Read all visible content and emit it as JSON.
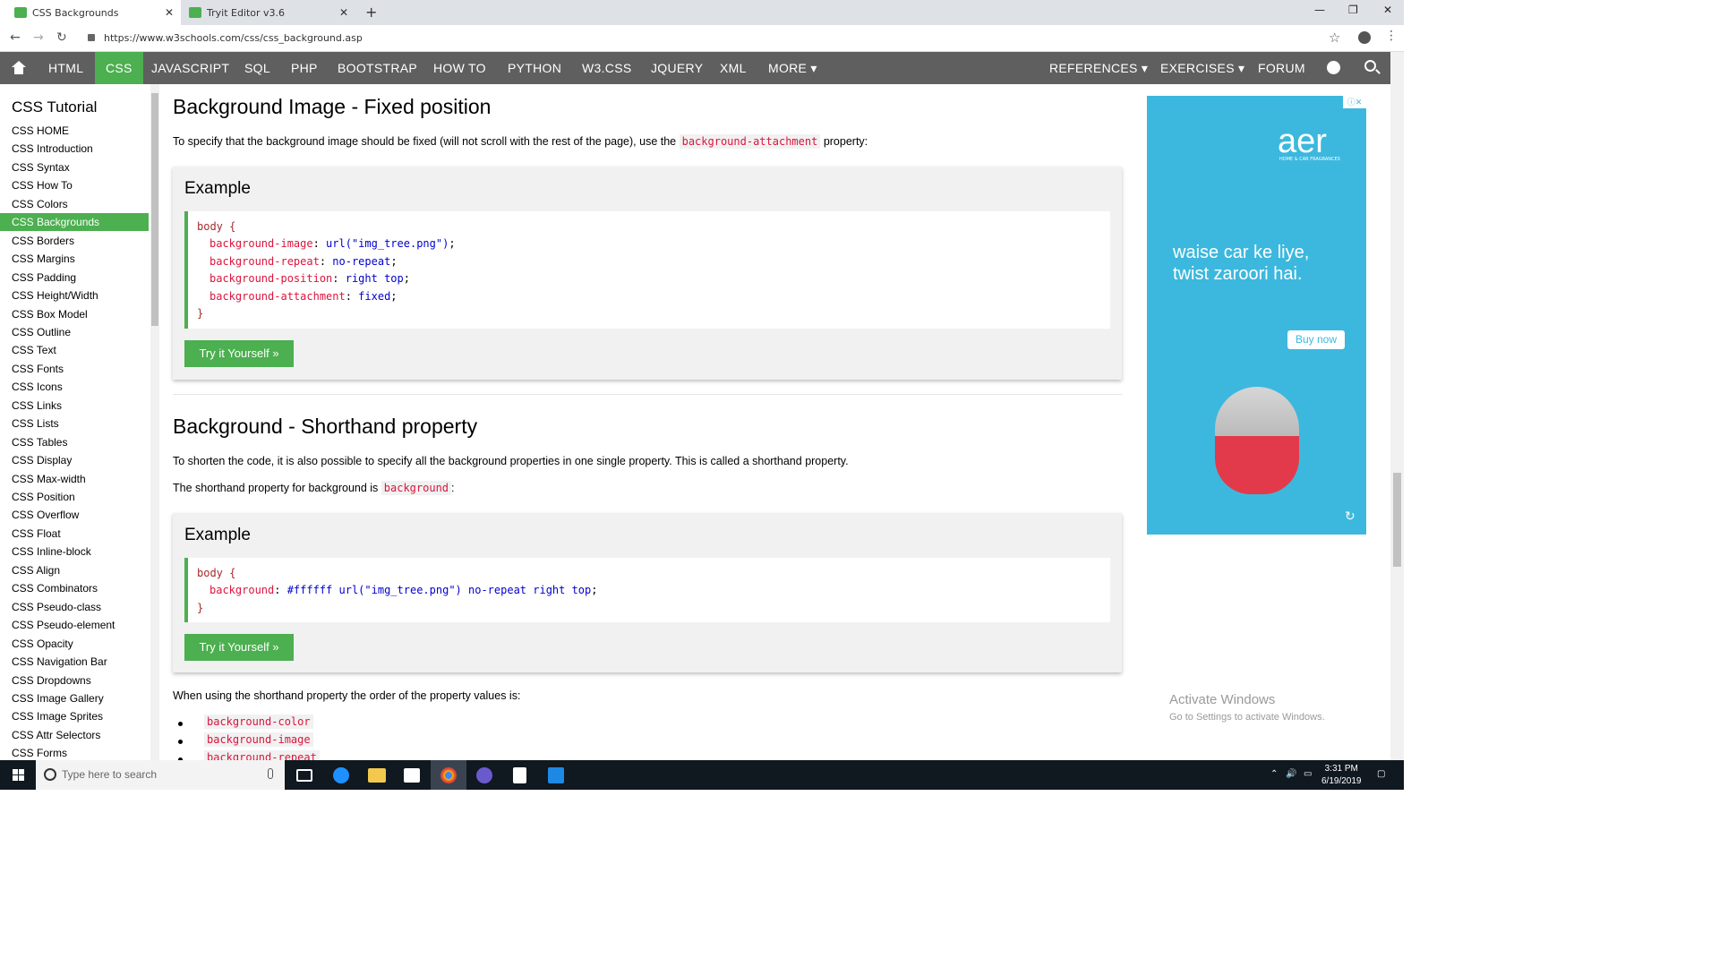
{
  "browser": {
    "tabs": [
      {
        "title": "CSS Backgrounds",
        "active": true
      },
      {
        "title": "Tryit Editor v3.6",
        "active": false
      }
    ],
    "url": "https://www.w3schools.com/css/css_background.asp"
  },
  "topnav": {
    "items": [
      "HTML",
      "CSS",
      "JAVASCRIPT",
      "SQL",
      "PHP",
      "BOOTSTRAP",
      "HOW TO",
      "PYTHON",
      "W3.CSS",
      "JQUERY",
      "XML",
      "MORE ▾"
    ],
    "active": "CSS",
    "right_items": [
      "REFERENCES ▾",
      "EXERCISES ▾",
      "FORUM"
    ],
    "accent": "#4caf50",
    "bar_color": "#5f5f5f"
  },
  "sidebar": {
    "title": "CSS Tutorial",
    "items": [
      "CSS HOME",
      "CSS Introduction",
      "CSS Syntax",
      "CSS How To",
      "CSS Colors",
      "CSS Backgrounds",
      "CSS Borders",
      "CSS Margins",
      "CSS Padding",
      "CSS Height/Width",
      "CSS Box Model",
      "CSS Outline",
      "CSS Text",
      "CSS Fonts",
      "CSS Icons",
      "CSS Links",
      "CSS Lists",
      "CSS Tables",
      "CSS Display",
      "CSS Max-width",
      "CSS Position",
      "CSS Overflow",
      "CSS Float",
      "CSS Inline-block",
      "CSS Align",
      "CSS Combinators",
      "CSS Pseudo-class",
      "CSS Pseudo-element",
      "CSS Opacity",
      "CSS Navigation Bar",
      "CSS Dropdowns",
      "CSS Image Gallery",
      "CSS Image Sprites",
      "CSS Attr Selectors",
      "CSS Forms"
    ],
    "active": "CSS Backgrounds"
  },
  "section1": {
    "heading": "Background Image - Fixed position",
    "para_before": "To specify that the background image should be fixed (will not scroll with the rest of the page), use the",
    "para_code": "background-attachment",
    "para_after": "property:",
    "example_title": "Example",
    "code": {
      "open": "body {",
      "lines": [
        {
          "prop": "background-image",
          "val": "url(\"img_tree.png\")"
        },
        {
          "prop": "background-repeat",
          "val": "no-repeat"
        },
        {
          "prop": "background-position",
          "val": "right top"
        },
        {
          "prop": "background-attachment",
          "val": "fixed"
        }
      ],
      "close": "}"
    },
    "try_label": "Try it Yourself »"
  },
  "section2": {
    "heading": "Background - Shorthand property",
    "para1": "To shorten the code, it is also possible to specify all the background properties in one single property. This is called a shorthand property.",
    "para2_before": "The shorthand property for background is",
    "para2_code": "background",
    "para2_after": ":",
    "example_title": "Example",
    "code": {
      "open": "body {",
      "lines": [
        {
          "prop": "background",
          "val": "#ffffff url(\"img_tree.png\") no-repeat right top"
        }
      ],
      "close": "}"
    },
    "try_label": "Try it Yourself »",
    "order_para": "When using the shorthand property the order of the property values is:",
    "order_list": [
      "background-color",
      "background-image",
      "background-repeat"
    ]
  },
  "ad": {
    "brand": "aer",
    "brand_sub": "HOME & CAR FRAGRANCES",
    "tagline1": "waise car ke liye,",
    "tagline2": "twist zaroori hai.",
    "cta": "Buy now",
    "bg": "#3cb8de"
  },
  "watermark": {
    "line1": "Activate Windows",
    "line2": "Go to Settings to activate Windows."
  },
  "taskbar": {
    "search_placeholder": "Type here to search",
    "time": "3:31 PM",
    "date": "6/19/2019"
  }
}
